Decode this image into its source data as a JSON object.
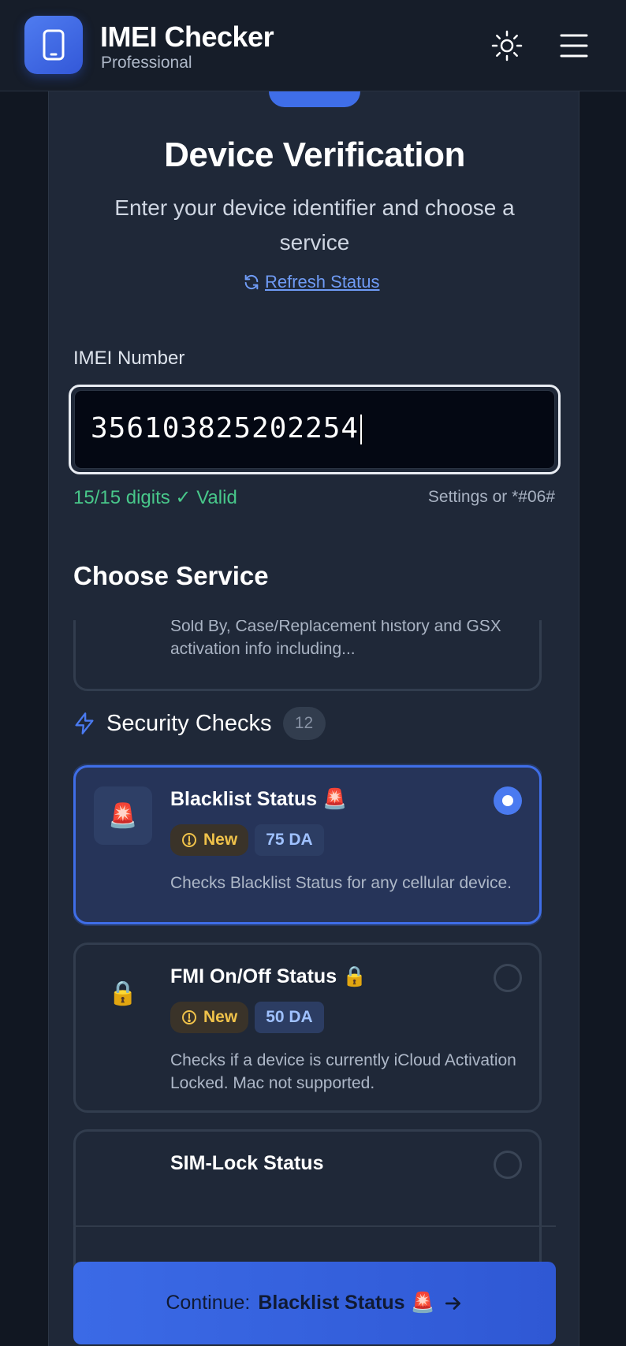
{
  "header": {
    "title": "IMEI Checker",
    "subtitle": "Professional",
    "logo_icon": "smartphone-icon",
    "theme_icon": "sun-icon",
    "menu_icon": "hamburger-menu-icon"
  },
  "main": {
    "title": "Device Verification",
    "subtitle": "Enter your device identifier and choose a service",
    "refresh_label": "Refresh Status",
    "imei": {
      "label": "IMEI Number",
      "value": "356103825202254",
      "status": "15/15 digits ✓ Valid",
      "hint": "Settings or *#06#"
    },
    "choose_title": "Choose Service",
    "partial_service": {
      "description": "Sold By, Case/Replacement history and GSX activation info including..."
    },
    "group": {
      "title": "Security Checks",
      "count": "12",
      "icon": "lightning-icon"
    },
    "services": [
      {
        "title": "Blacklist Status 🚨",
        "icon": "🚨",
        "badge_new": "New",
        "price": "75 DA",
        "description": "Checks Blacklist Status for any cellular device.",
        "selected": true
      },
      {
        "title": "FMI On/Off Status 🔒",
        "icon": "🔒",
        "badge_new": "New",
        "price": "50 DA",
        "description": "Checks if a device is currently iCloud Activation Locked. Mac not supported.",
        "selected": false
      },
      {
        "title": "SIM-Lock Status",
        "icon": "",
        "selected": false
      }
    ],
    "continue_prefix": "Continue:",
    "continue_service": "Blacklist Status 🚨"
  },
  "colors": {
    "accent": "#3f6ee8",
    "background": "#111722",
    "card": "#1f2838",
    "valid": "#48c78a",
    "badge_new": "#f0c24a"
  }
}
